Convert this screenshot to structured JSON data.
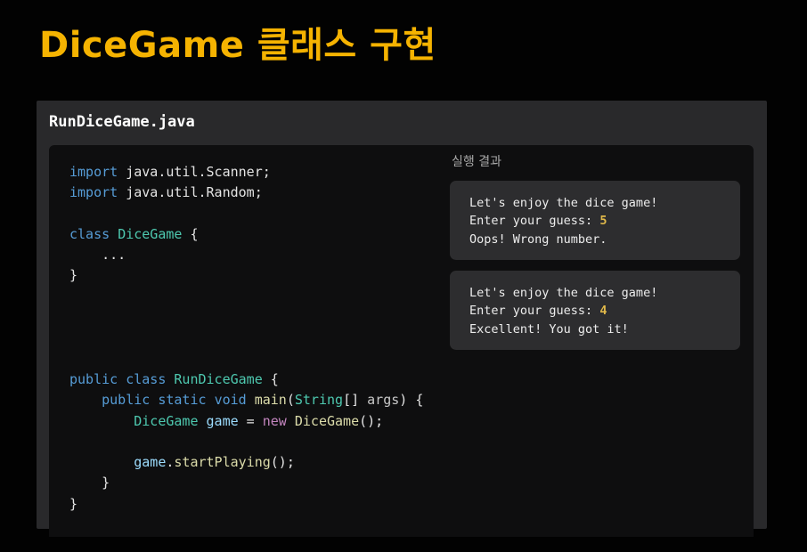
{
  "page": {
    "title": "DiceGame 클래스 구현"
  },
  "code_panel": {
    "filename": "RunDiceGame.java",
    "code": {
      "import1_kw": "import",
      "import1_rest": " java.util.Scanner;",
      "import2_kw": "import",
      "import2_rest": " java.util.Random;",
      "class1_kw": "class",
      "class1_name": "DiceGame",
      "class1_open": " {",
      "ellipsis": "    ...",
      "close1": "}",
      "class2_mod": "public",
      "class2_kw": "class",
      "class2_name": "RunDiceGame",
      "class2_open": " {",
      "main_mod1": "public",
      "main_mod2": "static",
      "main_ret": "void",
      "main_name": "main",
      "main_paren": "(",
      "main_ptype": "String",
      "main_pbr": "[] ",
      "main_pname": "args",
      "main_close": ") {",
      "decl_type": "DiceGame",
      "decl_var": "game",
      "decl_eq": " = ",
      "decl_new": "new",
      "decl_ctor": "DiceGame",
      "decl_end": "();",
      "call_obj": "game",
      "call_dot": ".",
      "call_method": "startPlaying",
      "call_end": "();",
      "close_main": "    }",
      "close2": "}"
    }
  },
  "results": {
    "label": "실행 결과",
    "runs": [
      {
        "line1": "Let's enjoy the dice game!",
        "line2_prefix": "Enter your guess: ",
        "guess": "5",
        "line3": "Oops! Wrong number."
      },
      {
        "line1": "Let's enjoy the dice game!",
        "line2_prefix": "Enter your guess: ",
        "guess": "4",
        "line3": "Excellent! You got it!"
      }
    ]
  }
}
